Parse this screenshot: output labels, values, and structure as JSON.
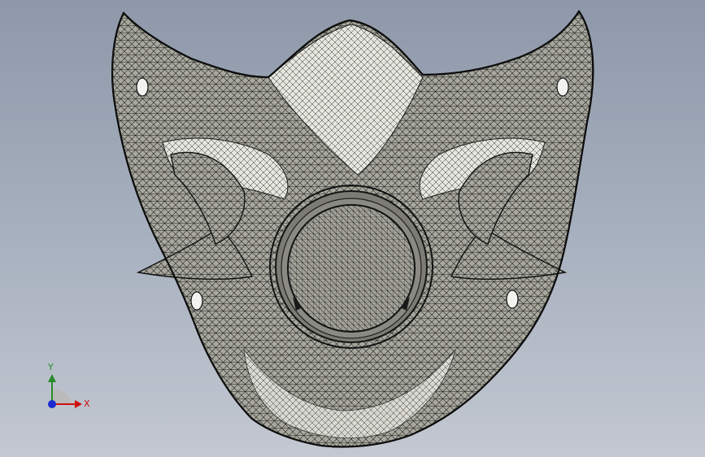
{
  "triad": {
    "x_label": "X",
    "y_label": "Y"
  },
  "colors": {
    "background_top": "#8e98a9",
    "background_bottom": "#c3c8d1",
    "model_shade": "#a6a69c",
    "mesh_line": "#1f1f1f",
    "axis_x": "#d01010",
    "axis_y": "#2a8a2a",
    "axis_z": "#1a2ad0"
  },
  "model": {
    "icon": "wireframe-mesh-mask"
  }
}
